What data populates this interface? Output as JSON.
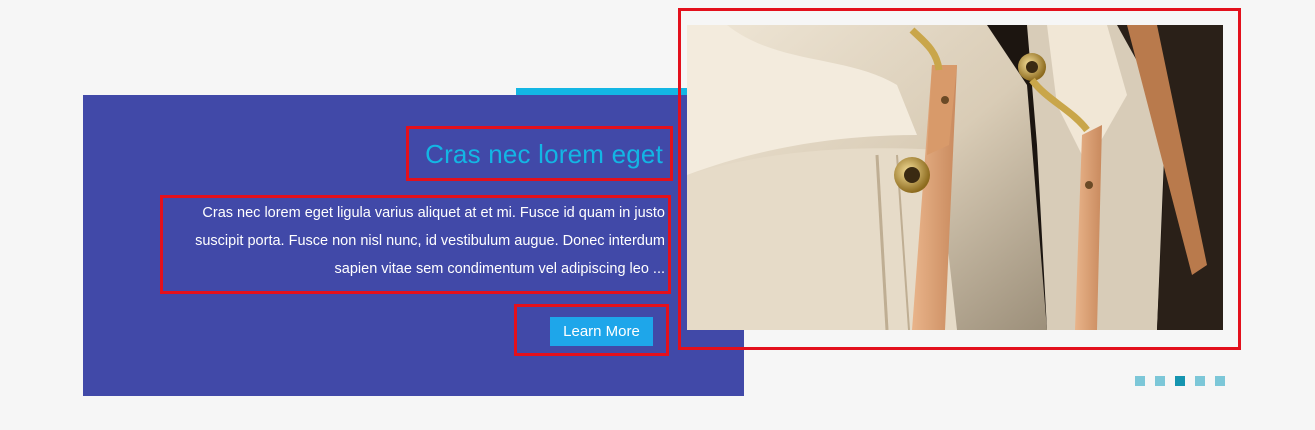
{
  "slide": {
    "title": "Cras nec lorem eget",
    "description": "Cras nec lorem eget ligula varius aliquet at et mi. Fusce id quam in justo suscipit porta. Fusce non nisl nunc, id vestibulum augue. Donec interdum sapien vitae sem condimentum vel adipiscing leo ...",
    "button_label": "Learn More",
    "image_icon": "canvas-bag-photo"
  },
  "pagination": {
    "total": 5,
    "active_index": 2
  },
  "colors": {
    "panel": "#4149a8",
    "accent": "#13b6e4",
    "button": "#1ea6ea",
    "highlight": "#e3101c",
    "dot": "#7cc7d8",
    "dot_active": "#1595b0"
  }
}
